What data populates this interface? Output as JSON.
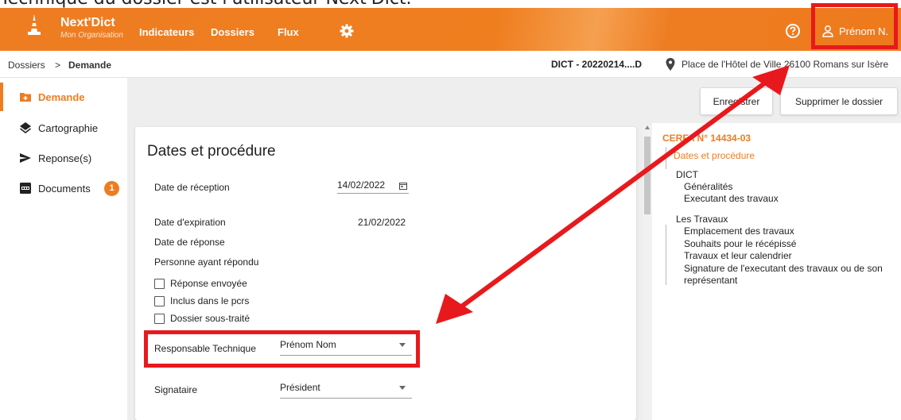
{
  "caption": "Technique du dossier est l'utilisateur Next'Dict.",
  "header": {
    "brand": "Next'Dict",
    "brand_sub": "Mon Organisation",
    "nav": [
      "Indicateurs",
      "Dossiers",
      "Flux"
    ],
    "user": "Prénom N."
  },
  "breadcrumb": {
    "parent": "Dossiers",
    "separator": ">",
    "current": "Demande",
    "reference": "DICT - 20220214....D",
    "address": "Place de l'Hôtel de Ville 26100 Romans sur Isère"
  },
  "sidebar": {
    "items": [
      {
        "label": "Demande",
        "icon": "folder-add-icon"
      },
      {
        "label": "Cartographie",
        "icon": "layers-icon"
      },
      {
        "label": "Reponse(s)",
        "icon": "send-icon"
      },
      {
        "label": "Documents",
        "icon": "pdf-icon",
        "badge": "1"
      }
    ]
  },
  "actions": {
    "save": "Enregistrer",
    "delete": "Supprimer le dossier"
  },
  "form": {
    "title": "Dates et procédure",
    "reception_label": "Date de réception",
    "reception_value": "14/02/2022",
    "expiration_label": "Date d'expiration",
    "expiration_value": "21/02/2022",
    "response_date_label": "Date de réponse",
    "responder_label": "Personne ayant répondu",
    "checkboxes": [
      "Réponse envoyée",
      "Inclus dans le pcrs",
      "Dossier sous-traité"
    ],
    "responsable_label": "Responsable Technique",
    "responsable_value": "Prénom Nom",
    "signataire_label": "Signataire",
    "signataire_value": "Président"
  },
  "toc": {
    "header": "CERFA N° 14434-03",
    "current_section": "Dates et procédure",
    "group1": "DICT",
    "group1_items": [
      "Généralités",
      "Executant des travaux"
    ],
    "group2": "Les Travaux",
    "group2_items": [
      "Emplacement des travaux",
      "Souhaits pour le récépissé",
      "Travaux et leur calendrier",
      "Signature de l'executant des travaux ou de son",
      "représentant"
    ]
  },
  "colors": {
    "accent": "#ee7d22",
    "annotation": "#e8191c"
  }
}
